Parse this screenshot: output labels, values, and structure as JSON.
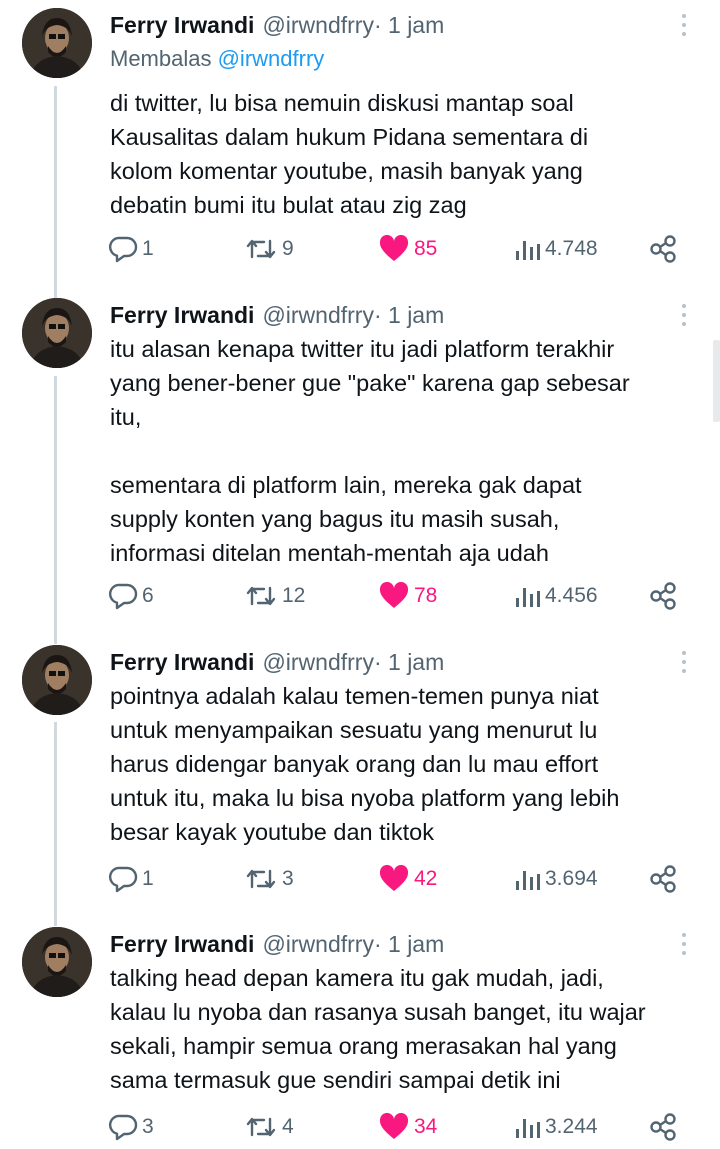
{
  "colors": {
    "accent": "#1d9bf0",
    "like": "#f91880",
    "muted": "#536471"
  },
  "tweets": [
    {
      "name": "Ferry Irwandi",
      "handle": "@irwndfrry",
      "time": " · 1 jam",
      "reply_prefix": "Membalas ",
      "reply_handle": "@irwndfrry",
      "text": "di twitter, lu bisa nemuin diskusi mantap soal\nKausalitas dalam hukum Pidana sementara di\nkolom komentar youtube, masih banyak yang\ndebatin bumi itu bulat atau zig zag",
      "replies": "1",
      "retweets": "9",
      "likes": "85",
      "views": "4.748"
    },
    {
      "name": "Ferry Irwandi",
      "handle": "@irwndfrry",
      "time": " · 1 jam",
      "text": "itu alasan kenapa twitter itu jadi platform terakhir\nyang bener-bener gue \"pake\" karena gap sebesar\nitu,\n\nsementara di platform lain, mereka gak dapat\nsupply konten yang bagus itu masih susah,\ninformasi ditelan mentah-mentah aja udah",
      "replies": "6",
      "retweets": "12",
      "likes": "78",
      "views": "4.456"
    },
    {
      "name": "Ferry Irwandi",
      "handle": "@irwndfrry",
      "time": " · 1 jam",
      "text": "pointnya adalah kalau temen-temen punya niat\nuntuk menyampaikan sesuatu yang menurut lu\nharus didengar banyak orang dan lu mau effort\nuntuk itu, maka lu bisa nyoba platform yang lebih\nbesar kayak youtube dan tiktok",
      "replies": "1",
      "retweets": "3",
      "likes": "42",
      "views": "3.694"
    },
    {
      "name": "Ferry Irwandi",
      "handle": "@irwndfrry",
      "time": " · 1 jam",
      "text": "talking head depan kamera itu gak mudah, jadi,\nkalau lu nyoba dan rasanya susah banget, itu wajar\nsekali, hampir semua orang merasakan hal yang\nsama termasuk gue sendiri sampai detik ini",
      "replies": "3",
      "retweets": "4",
      "likes": "34",
      "views": "3.244"
    }
  ]
}
